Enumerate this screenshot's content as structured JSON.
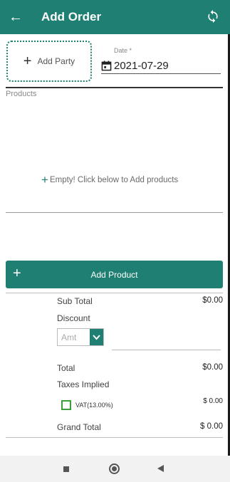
{
  "appbar": {
    "title": "Add Order",
    "back_icon": "back-arrow-icon",
    "sync_icon": "sync-icon"
  },
  "party": {
    "add_label": "Add Party",
    "icon": "plus-icon"
  },
  "date": {
    "label": "Date *",
    "value": "2021-07-29",
    "icon": "calendar-icon"
  },
  "products": {
    "label": "Products",
    "empty_text": "Empty! Click below to Add products"
  },
  "add_product": {
    "label": "Add Product",
    "icon": "plus-icon"
  },
  "summary": {
    "sub_total_label": "Sub Total",
    "sub_total_value": "$0.00",
    "discount_label": "Discount",
    "discount_placeholder": "Amt",
    "total_label": "Total",
    "total_value": "$0.00",
    "taxes_label": "Taxes Implied",
    "vat_label": "VAT(13.00%)",
    "vat_value": "$ 0.00",
    "vat_checked": false,
    "grand_total_label": "Grand Total",
    "grand_total_value": "$ 0.00"
  },
  "colors": {
    "primary": "#1f7f73",
    "checkbox": "#3a9f3a"
  }
}
